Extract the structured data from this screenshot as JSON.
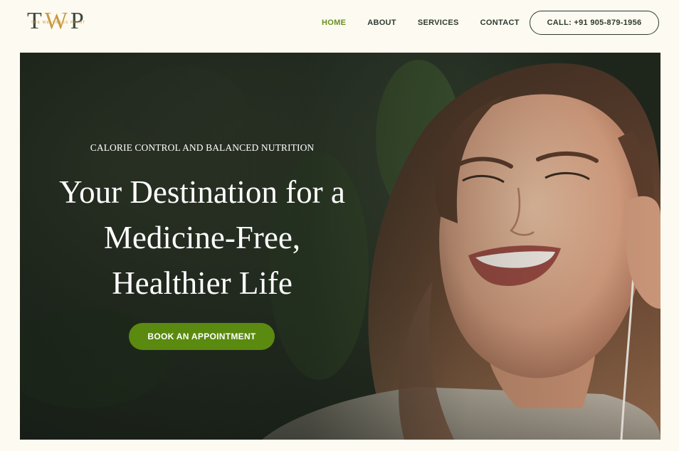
{
  "header": {
    "logo": {
      "letters": "TWP",
      "tagline": "THE WELLNESS POINT"
    },
    "nav": [
      {
        "label": "HOME",
        "active": true
      },
      {
        "label": "ABOUT",
        "active": false
      },
      {
        "label": "SERVICES",
        "active": false
      },
      {
        "label": "CONTACT",
        "active": false
      }
    ],
    "call_label": "CALL: +91 905-879-1956"
  },
  "hero": {
    "eyebrow": "CALORIE CONTROL AND BALANCED NUTRITION",
    "headline_lines": [
      "Your Destination for a",
      "Medicine-Free,",
      "Healthier Life"
    ],
    "cta_label": "BOOK AN APPOINTMENT",
    "image_subject": "smiling-woman-with-earphones"
  },
  "colors": {
    "background": "#fdfaf1",
    "accent_green": "#5a8a0f",
    "nav_active": "#6b8e23",
    "text_dark": "#2d3a2e",
    "logo_gold": "#c99a45"
  }
}
